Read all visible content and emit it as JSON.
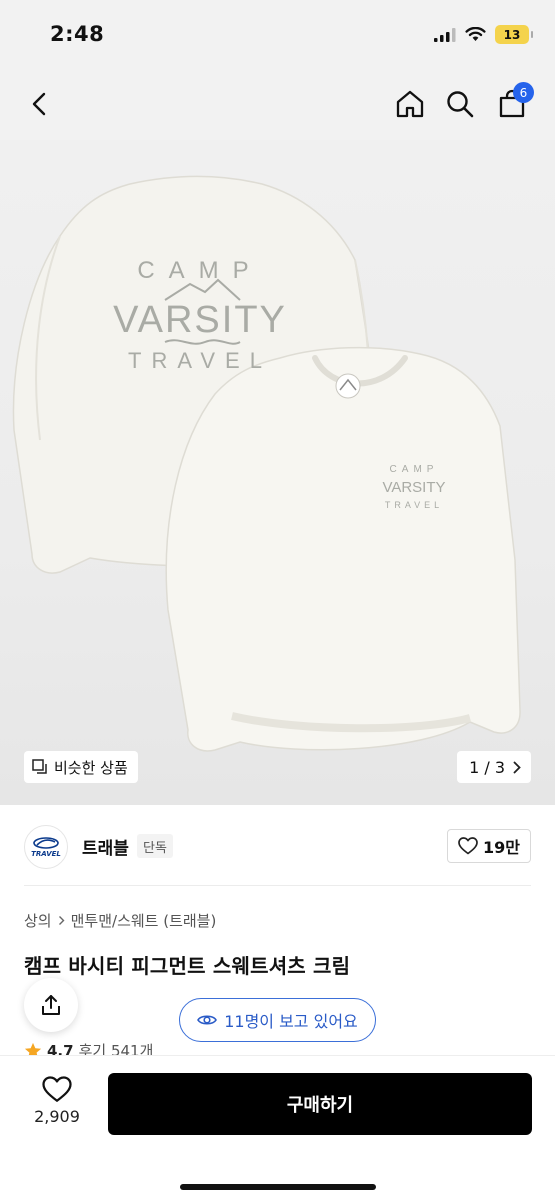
{
  "status_bar": {
    "time": "2:48",
    "battery": "13"
  },
  "header": {
    "cart_count": "6"
  },
  "product_image": {
    "back_print": {
      "line1": "CAMP",
      "line2": "VARSITY",
      "line3": "TRAVEL"
    },
    "front_print": {
      "line1": "CAMP",
      "line2": "VARSITY",
      "line3": "TRAVEL"
    },
    "similar_label": "비슷한 상품",
    "pager": "1 / 3"
  },
  "brand": {
    "logo_text": "TRAVEL",
    "name": "트래블",
    "tag": "단독",
    "likes": "19만"
  },
  "breadcrumb": {
    "category": "상의",
    "subcategory": "맨투맨/스웨트 (트래블)"
  },
  "product": {
    "title": "캠프 바시티 피그먼트 스웨트셔츠 크림"
  },
  "viewers": {
    "label": "11명이 보고 있어요"
  },
  "rating": {
    "score": "4.7",
    "reviews": "후기 541개"
  },
  "bottom_bar": {
    "wish_count": "2,909",
    "buy_label": "구매하기"
  },
  "colors": {
    "accent": "#2563eb",
    "buy": "#000000",
    "star": "#f5a623"
  }
}
